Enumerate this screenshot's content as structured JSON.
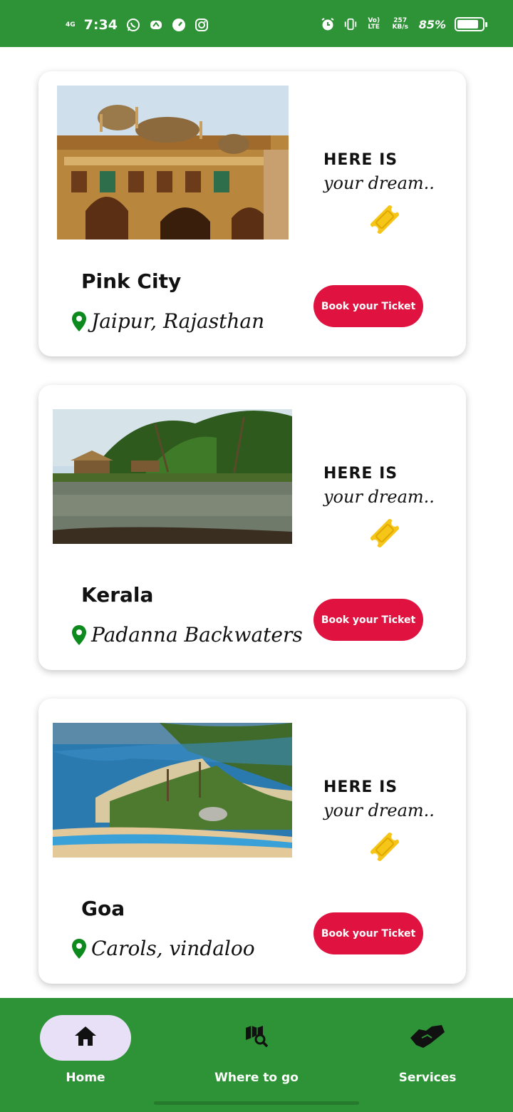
{
  "status_bar": {
    "network": "4G",
    "time": "7:34",
    "volte": "Vo) LTE",
    "speed": "257 KB/s",
    "battery_percent": "85%",
    "battery_level": 0.85
  },
  "cards": [
    {
      "tagline_1": "HERE IS",
      "tagline_2": "your dream..",
      "name": "Pink City",
      "location": "Jaipur, Rajasthan",
      "button": "Book your Ticket"
    },
    {
      "tagline_1": "HERE IS",
      "tagline_2": "your dream..",
      "name": "Kerala",
      "location": "Padanna Backwaters",
      "button": "Book your Ticket"
    },
    {
      "tagline_1": "HERE IS",
      "tagline_2": "your dream..",
      "name": "Goa",
      "location": "Carols, vindaloo",
      "button": "Book your Ticket"
    }
  ],
  "nav": {
    "items": [
      {
        "label": "Home",
        "icon": "home-icon",
        "active": true
      },
      {
        "label": "Where to go",
        "icon": "map-search-icon",
        "active": false
      },
      {
        "label": "Services",
        "icon": "handshake-icon",
        "active": false
      }
    ]
  },
  "colors": {
    "primary_green": "#2e9236",
    "button_red": "#e0123f",
    "ticket_yellow": "#f5c518",
    "active_pill": "#e8e0f6",
    "pin_green": "#0c8a1e"
  }
}
